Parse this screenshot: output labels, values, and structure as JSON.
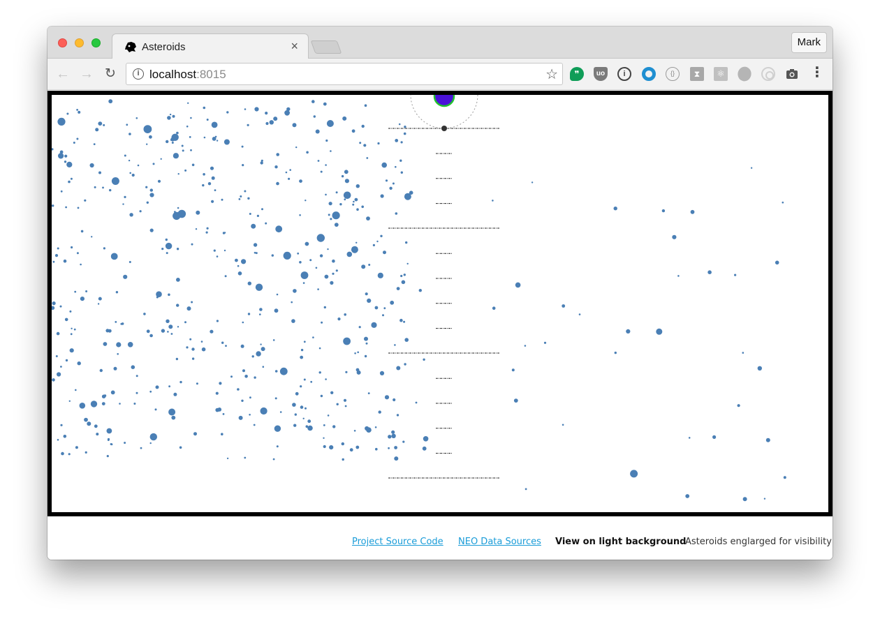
{
  "browser": {
    "profile_name": "Mark",
    "tab": {
      "title": "Asteroids",
      "close_glyph": "×",
      "favicon": "asteroid-icon"
    },
    "address": {
      "host": "localhost",
      "port": ":8015"
    },
    "extensions": [
      "hangouts-icon",
      "ublock-icon",
      "onepassword-icon",
      "ring-icon",
      "json-icon",
      "hourglass-icon",
      "react-icon",
      "football-icon",
      "target-icon",
      "camera-icon"
    ]
  },
  "footer": {
    "source_link": "Project Source Code",
    "neo_link": "NEO Data Sources",
    "background_toggle": "View on light background",
    "note": "Asteroids englarged for visibility"
  },
  "colors": {
    "asteroid": "#4a7fb5",
    "earth_fill": "#4a12d8",
    "earth_ring": "#22c32e",
    "frame": "#000000"
  }
}
